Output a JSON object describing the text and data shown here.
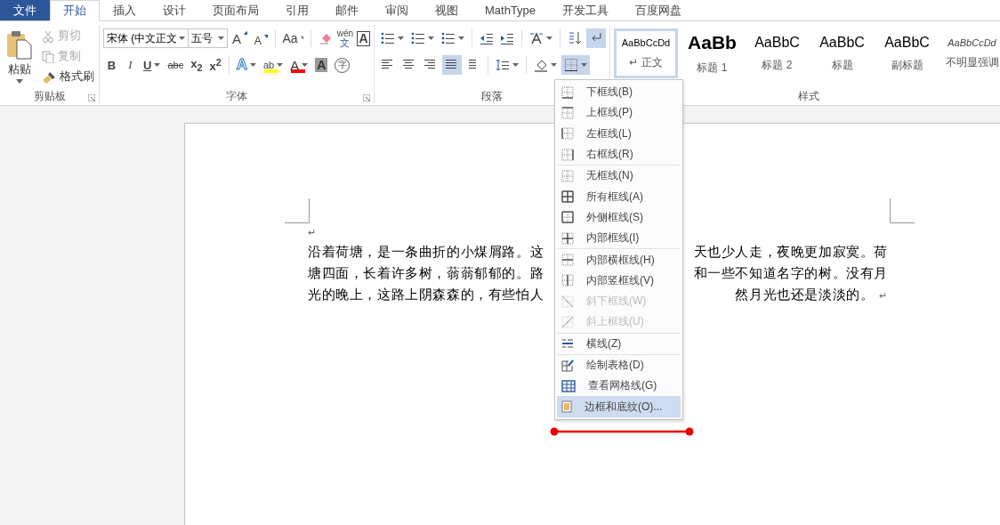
{
  "tabs": [
    {
      "label": "文件",
      "kind": "file",
      "selected": false
    },
    {
      "label": "开始",
      "kind": "tab",
      "selected": true
    },
    {
      "label": "插入",
      "kind": "tab",
      "selected": false
    },
    {
      "label": "设计",
      "kind": "tab",
      "selected": false
    },
    {
      "label": "页面布局",
      "kind": "tab",
      "selected": false
    },
    {
      "label": "引用",
      "kind": "tab",
      "selected": false
    },
    {
      "label": "邮件",
      "kind": "tab",
      "selected": false
    },
    {
      "label": "审阅",
      "kind": "tab",
      "selected": false
    },
    {
      "label": "视图",
      "kind": "tab",
      "selected": false
    },
    {
      "label": "MathType",
      "kind": "tab",
      "selected": false
    },
    {
      "label": "开发工具",
      "kind": "tab",
      "selected": false
    },
    {
      "label": "百度网盘",
      "kind": "tab",
      "selected": false
    }
  ],
  "clipboard": {
    "paste": "粘贴",
    "label": "剪贴板",
    "items": [
      {
        "label": "剪切",
        "kind": "cut",
        "disabled": true
      },
      {
        "label": "复制",
        "kind": "copy",
        "disabled": true
      },
      {
        "label": "格式刷",
        "kind": "painter",
        "disabled": false
      }
    ]
  },
  "font": {
    "label": "字体",
    "face": "宋体 (中文正文",
    "size": "五号",
    "row1": [
      {
        "text": "A",
        "kind": "grow"
      },
      {
        "text": "A",
        "kind": "shrink"
      },
      {
        "text": "Aa",
        "kind": "case",
        "dropdown": true
      },
      {
        "kind": "clear"
      },
      {
        "text": "wén",
        "sub": "文",
        "kind": "phonetic"
      },
      {
        "text": "A",
        "kind": "boxed"
      }
    ],
    "row2": [
      {
        "text": "B",
        "kind": "bold"
      },
      {
        "text": "I",
        "kind": "italic"
      },
      {
        "text": "U",
        "kind": "underline",
        "dropdown": true
      },
      {
        "text": "abc",
        "kind": "strike"
      },
      {
        "text": "x$_{2}$",
        "kind": "script"
      },
      {
        "text": "x$^{2}$",
        "kind": "script"
      },
      {
        "text": "A",
        "kind": "effect",
        "dropdown": true
      },
      {
        "text": "ab",
        "kind": "highlight",
        "color": "#ffff00",
        "dropdown": true
      },
      {
        "text": "A",
        "kind": "fontcolor",
        "color": "#ff0000",
        "dropdown": true
      },
      {
        "text": "A",
        "kind": "shaded"
      },
      {
        "text": "字",
        "kind": "enclosed"
      }
    ]
  },
  "paragraph": {
    "label": "段落",
    "row1": [
      {
        "kind": "bullets",
        "dropdown": true,
        "selected": false
      },
      {
        "kind": "numbering",
        "dropdown": true,
        "selected": false
      },
      {
        "kind": "multilevel",
        "dropdown": true,
        "selected": false
      },
      {
        "kind": "outdent",
        "selected": false
      },
      {
        "kind": "indent",
        "selected": false
      },
      {
        "kind": "asian",
        "dropdown": true,
        "selected": false
      },
      {
        "kind": "sort",
        "selected": false
      },
      {
        "kind": "marks",
        "selected": true
      }
    ],
    "row2": [
      {
        "kind": "left",
        "selected": false
      },
      {
        "kind": "center",
        "selected": false
      },
      {
        "kind": "right",
        "selected": false
      },
      {
        "kind": "justify",
        "selected": true
      },
      {
        "kind": "distributed",
        "selected": false
      },
      {
        "kind": "spacing",
        "dropdown": true,
        "selected": false
      },
      {
        "kind": "shading",
        "dropdown": true,
        "selected": false
      },
      {
        "kind": "borders",
        "dropdown": true,
        "selected": true
      }
    ]
  },
  "styles": {
    "label": "样式",
    "items": [
      {
        "preview": "AaBbCcDd",
        "mark": "↵",
        "name": "正文",
        "kind": "normal",
        "selected": true
      },
      {
        "preview": "AaBb",
        "name": "标题 1",
        "kind": "h1",
        "selected": false
      },
      {
        "preview": "AaBbC",
        "name": "标题 2",
        "kind": "h2",
        "selected": false
      },
      {
        "preview": "AaBbC",
        "name": "标题",
        "kind": "title",
        "selected": false
      },
      {
        "preview": "AaBbC",
        "name": "副标题",
        "kind": "subtitle",
        "selected": false
      },
      {
        "preview": "AaBbCcDd",
        "name": "不明显强调",
        "kind": "emph",
        "selected": false
      }
    ]
  },
  "document": {
    "para_mark": "↵",
    "lines": [
      {
        "left": "沿着荷塘，是一条曲折的小煤屑路。这",
        "right": "天也少人走，夜晚更加寂寞。荷"
      },
      {
        "left": "塘四面，长着许多树，蓊蓊郁郁的。路",
        "right": "和一些不知道名字的树。没有月"
      },
      {
        "left": "光的晚上，这路上阴森森的，有些怕人",
        "right": "然月光也还是淡淡的。",
        "end": "↵"
      }
    ]
  },
  "menu": [
    {
      "label": "下框线(B)",
      "kind": "bottom",
      "disabled": false,
      "selected": false,
      "separator": false
    },
    {
      "label": "上框线(P)",
      "kind": "top",
      "disabled": false,
      "selected": false,
      "separator": false
    },
    {
      "label": "左框线(L)",
      "kind": "left",
      "disabled": false,
      "selected": false,
      "separator": false
    },
    {
      "label": "右框线(R)",
      "kind": "right",
      "disabled": false,
      "selected": false,
      "separator": false
    },
    {
      "label": "无框线(N)",
      "kind": "none",
      "disabled": false,
      "selected": false,
      "separator": true
    },
    {
      "label": "所有框线(A)",
      "kind": "all",
      "disabled": false,
      "selected": false,
      "separator": false
    },
    {
      "label": "外侧框线(S)",
      "kind": "outside",
      "disabled": false,
      "selected": false,
      "separator": false
    },
    {
      "label": "内部框线(I)",
      "kind": "inside",
      "disabled": false,
      "selected": false,
      "separator": false
    },
    {
      "label": "内部横框线(H)",
      "kind": "insideh",
      "disabled": false,
      "selected": false,
      "separator": true
    },
    {
      "label": "内部竖框线(V)",
      "kind": "insidev",
      "disabled": false,
      "selected": false,
      "separator": false
    },
    {
      "label": "斜下框线(W)",
      "kind": "diagdown",
      "disabled": true,
      "selected": false,
      "separator": false
    },
    {
      "label": "斜上框线(U)",
      "kind": "diagup",
      "disabled": true,
      "selected": false,
      "separator": false
    },
    {
      "label": "横线(Z)",
      "kind": "hline",
      "disabled": false,
      "selected": false,
      "separator": true
    },
    {
      "label": "绘制表格(D)",
      "kind": "draw",
      "disabled": false,
      "selected": false,
      "separator": true
    },
    {
      "label": "查看网格线(G)",
      "kind": "grid",
      "disabled": false,
      "selected": false,
      "separator": false
    },
    {
      "label": "边框和底纹(O)...",
      "kind": "dialog",
      "disabled": false,
      "selected": true,
      "separator": false
    }
  ]
}
